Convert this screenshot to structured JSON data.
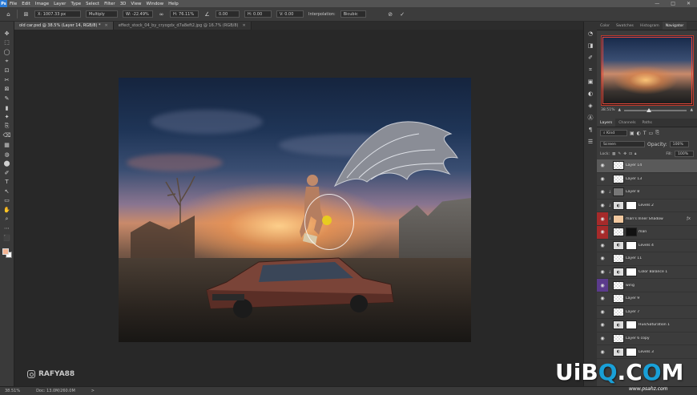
{
  "app": {
    "logo": "Ps"
  },
  "menu": [
    "File",
    "Edit",
    "Image",
    "Layer",
    "Type",
    "Select",
    "Filter",
    "3D",
    "View",
    "Window",
    "Help"
  ],
  "window_controls": [
    "—",
    "□",
    "✕"
  ],
  "options_bar": {
    "x_value": "X: 1007.33 px",
    "blend_mode": "Multiply",
    "w_value": "W: -22.49%",
    "h_value": "H: 76.11%",
    "angle": "0.00",
    "h_skew": "H: 0.00",
    "v_skew": "V: 0.00",
    "interpolation_label": "Interpolation:",
    "interpolation": "Bicubic"
  },
  "tabs": [
    {
      "label": "old car.psd @ 38.5% (Layer 14, RGB/8) *",
      "active": true
    },
    {
      "label": "effect_stock_04_by_cryogdx_d7a8eft2.jpg @ 16.7% (RGB/8)",
      "active": false
    }
  ],
  "tools": [
    "✥",
    "⬚",
    "◯",
    "⌖",
    "⊡",
    "✂",
    "⊠",
    "✎",
    "▮",
    "✦",
    "⎘",
    "⌫",
    "▦",
    "◍",
    "⬤",
    "✐",
    "T",
    "↖",
    "▭",
    "✋",
    "⌕",
    "⋯",
    "⬛"
  ],
  "watermark": {
    "handle": "RAFYA88"
  },
  "status": {
    "zoom": "38.51%",
    "doc": "Doc: 13.0M/260.0M",
    "arrow": ">"
  },
  "panel_strip_icons": [
    "◔",
    "◨",
    "✐",
    "⌗",
    "▣",
    "◐",
    "◈",
    "Ⓐ",
    "¶",
    "☰"
  ],
  "top_panel_tabs": [
    "Color",
    "Swatches",
    "Histogram",
    "Navigator"
  ],
  "navigator": {
    "zoom": "38.51%"
  },
  "layers_tabs": [
    "Layers",
    "Channels",
    "Paths"
  ],
  "layers_panel": {
    "kind_filter": "Kind",
    "blend_mode": "Screen",
    "opacity_label": "Opacity:",
    "opacity": "100%",
    "lock_label": "Lock:",
    "fill_label": "Fill:",
    "fill": "100%"
  },
  "layers": [
    {
      "name": "Layer 14",
      "thumb": "checker",
      "mask": "",
      "eye": "normal",
      "selected": true,
      "indent": ""
    },
    {
      "name": "Layer 13",
      "thumb": "checker",
      "mask": "",
      "eye": "normal",
      "selected": false,
      "indent": ""
    },
    {
      "name": "Layer 8",
      "thumb": "gray",
      "mask": "",
      "eye": "normal",
      "selected": false,
      "indent": "↓"
    },
    {
      "name": "Levels 2",
      "thumb": "adj",
      "mask": "white",
      "eye": "normal",
      "selected": false,
      "indent": "↓"
    },
    {
      "name": "man's Inner Shadow",
      "thumb": "peach",
      "mask": "",
      "eye": "red",
      "selected": false,
      "indent": "↓"
    },
    {
      "name": "man",
      "thumb": "checker",
      "mask": "black",
      "eye": "red",
      "selected": false,
      "indent": ""
    },
    {
      "name": "Levels 4",
      "thumb": "adj",
      "mask": "white",
      "eye": "normal",
      "selected": false,
      "indent": ""
    },
    {
      "name": "Layer 11",
      "thumb": "checker",
      "mask": "",
      "eye": "normal",
      "selected": false,
      "indent": ""
    },
    {
      "name": "Color Balance 1",
      "thumb": "adj",
      "mask": "white",
      "eye": "normal",
      "selected": false,
      "indent": "↓"
    },
    {
      "name": "wing",
      "thumb": "checker",
      "mask": "",
      "eye": "purple",
      "selected": false,
      "indent": ""
    },
    {
      "name": "Layer 9",
      "thumb": "checker",
      "mask": "",
      "eye": "normal",
      "selected": false,
      "indent": ""
    },
    {
      "name": "Layer 7",
      "thumb": "checker",
      "mask": "",
      "eye": "normal",
      "selected": false,
      "indent": ""
    },
    {
      "name": "Hue/Saturation 1",
      "thumb": "adj",
      "mask": "white",
      "eye": "normal",
      "selected": false,
      "indent": ""
    },
    {
      "name": "Layer 6 copy",
      "thumb": "checker",
      "mask": "",
      "eye": "normal",
      "selected": false,
      "indent": ""
    },
    {
      "name": "Levels 3",
      "thumb": "adj",
      "mask": "white",
      "eye": "normal",
      "selected": false,
      "indent": ""
    }
  ],
  "site_logo": {
    "u": "U",
    "i": "i",
    "b": "B",
    "o": "Q",
    "dot": ".",
    "c": "C",
    "o2": "O",
    "m": "M"
  },
  "site_url": "www.psahz.com",
  "colors": {
    "foreground": "#f3b493",
    "background": "#ffffff",
    "selected_layer": "#5a5a5a",
    "eye_red": "#a62a2a",
    "eye_purple": "#5b3b8c"
  }
}
